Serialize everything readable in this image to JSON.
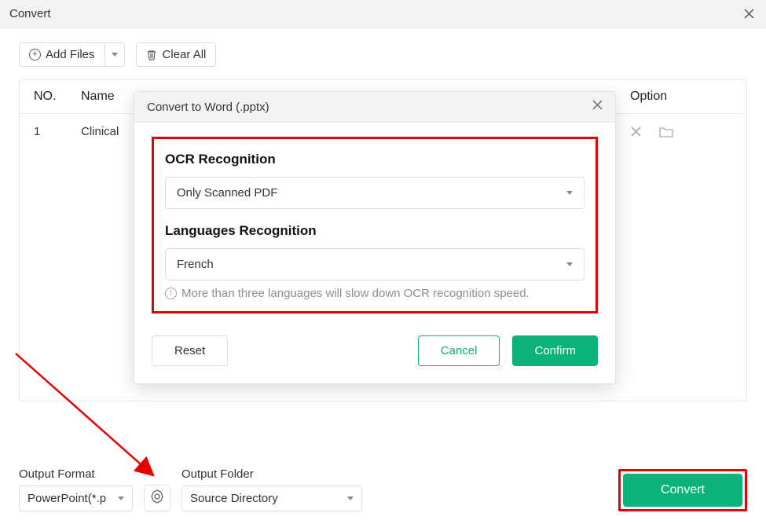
{
  "window": {
    "title": "Convert"
  },
  "toolbar": {
    "add_files_label": "Add Files",
    "clear_all_label": "Clear All"
  },
  "table": {
    "headers": {
      "no": "NO.",
      "name": "Name",
      "option": "Option"
    },
    "rows": [
      {
        "no": "1",
        "name": "Clinical"
      }
    ]
  },
  "modal": {
    "title": "Convert to Word (.pptx)",
    "ocr_section_label": "OCR Recognition",
    "ocr_value": "Only Scanned PDF",
    "lang_section_label": "Languages Recognition",
    "lang_value": "French",
    "hint": "More than three languages will slow down OCR recognition speed.",
    "reset_label": "Reset",
    "cancel_label": "Cancel",
    "confirm_label": "Confirm"
  },
  "bottom": {
    "output_format_label": "Output Format",
    "output_format_value": "PowerPoint(*.p",
    "output_folder_label": "Output Folder",
    "output_folder_value": "Source Directory",
    "convert_label": "Convert"
  }
}
